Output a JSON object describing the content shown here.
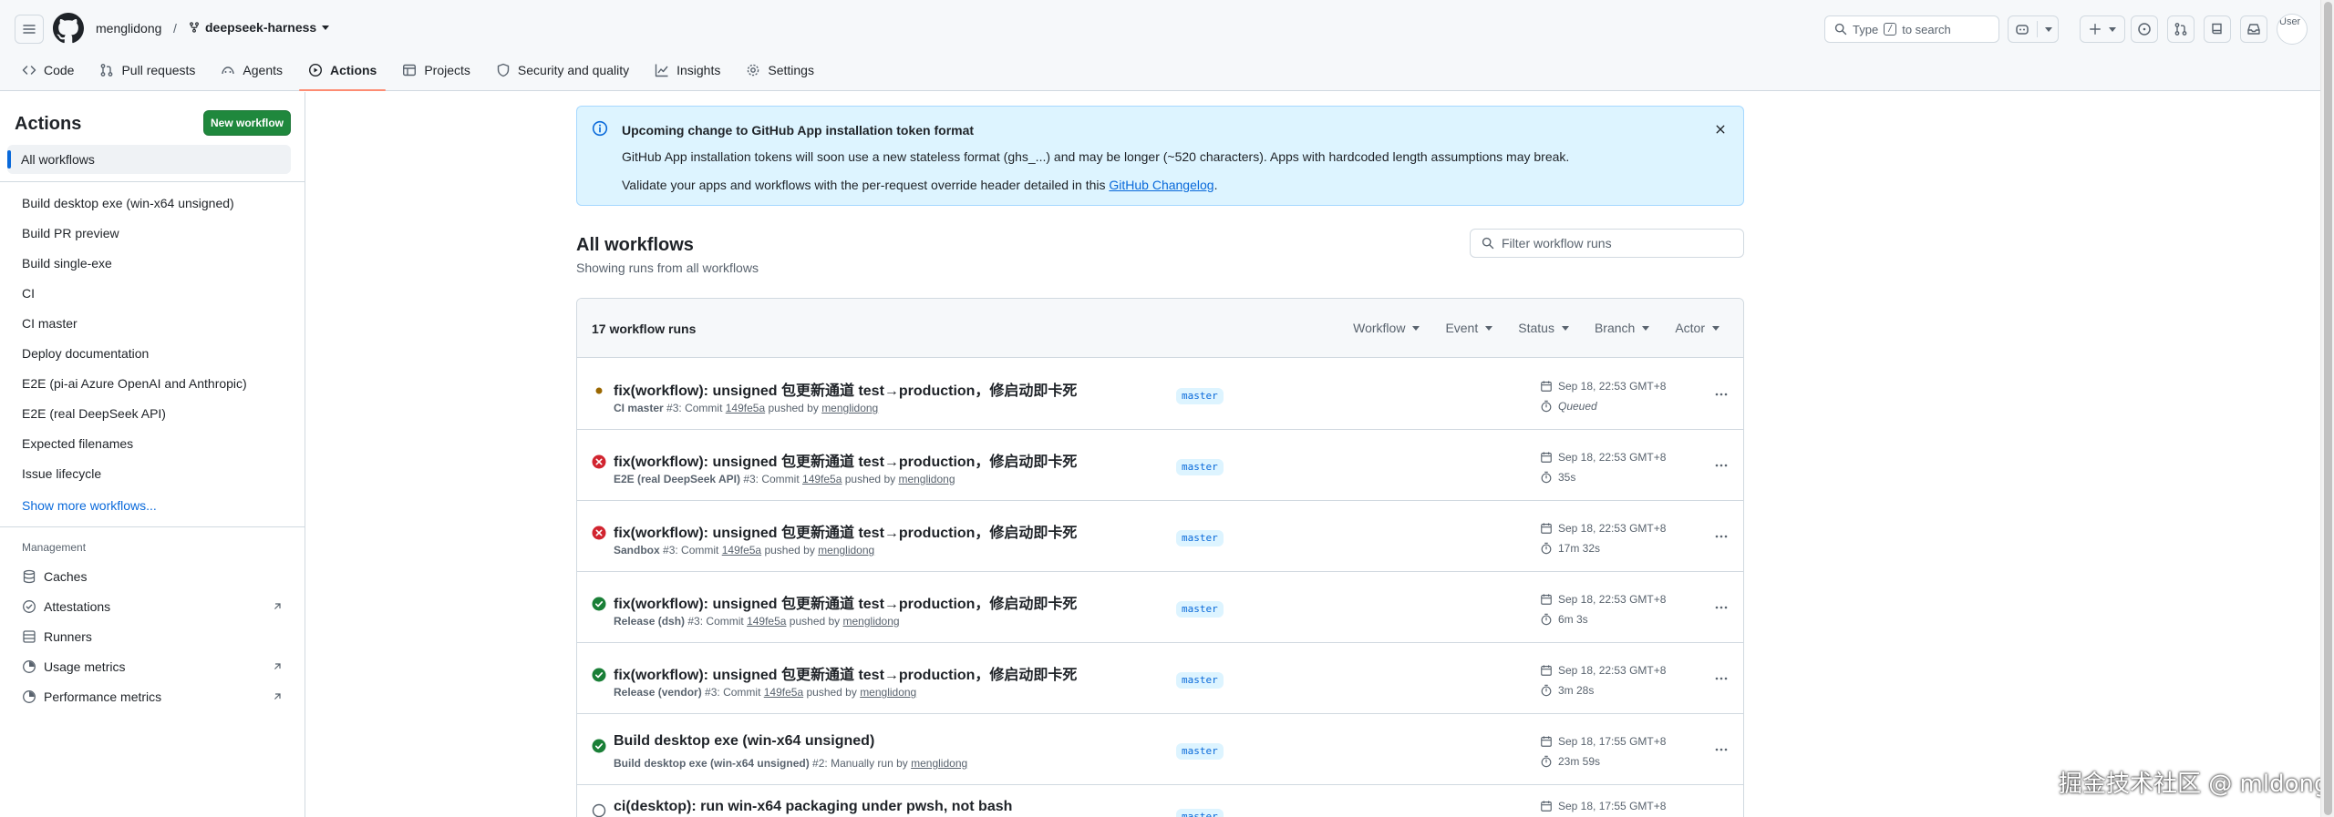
{
  "repo": {
    "owner": "menglidong",
    "separator": "/",
    "name": "deepseek-harness"
  },
  "search": {
    "prefix": "Type",
    "key": "/",
    "suffix": "to search"
  },
  "avatar_alt": "User",
  "nav": {
    "code": "Code",
    "pulls": "Pull requests",
    "agents": "Agents",
    "actions": "Actions",
    "projects": "Projects",
    "security": "Security and quality",
    "insights": "Insights",
    "settings": "Settings"
  },
  "sidebar": {
    "title": "Actions",
    "new_workflow": "New workflow",
    "all_workflows": "All workflows",
    "workflows": [
      "Build desktop exe (win-x64 unsigned)",
      "Build PR preview",
      "Build single-exe",
      "CI",
      "CI master",
      "Deploy documentation",
      "E2E (pi-ai Azure OpenAI and Anthropic)",
      "E2E (real DeepSeek API)",
      "Expected filenames",
      "Issue lifecycle"
    ],
    "show_more": "Show more workflows...",
    "management_label": "Management",
    "management": [
      "Caches",
      "Attestations",
      "Runners",
      "Usage metrics",
      "Performance metrics"
    ]
  },
  "banner": {
    "title": "Upcoming change to GitHub App installation token format",
    "line1": "GitHub App installation tokens will soon use a new stateless format (ghs_...) and may be longer (~520 characters). Apps with hardcoded length assumptions may break.",
    "line2_prefix": "Validate your apps and workflows with the per-request override header detailed in this ",
    "line2_link": "GitHub Changelog",
    "line2_suffix": "."
  },
  "main": {
    "title": "All workflows",
    "subtitle": "Showing runs from all workflows",
    "filter_placeholder": "Filter workflow runs",
    "count": "17 workflow runs",
    "filters": [
      "Workflow",
      "Event",
      "Status",
      "Branch",
      "Actor"
    ]
  },
  "runs": [
    {
      "status": "queued",
      "title": "fix(workflow): unsigned 包更新通道 test→production，修启动即卡死",
      "workflow": "CI master",
      "run_no": "#3",
      "verb": ": Commit ",
      "sha": "149fe5a",
      "by": " pushed by ",
      "actor": "menglidong",
      "branch": "master",
      "date": "Sep 18, 22:53 GMT+8",
      "duration": "Queued"
    },
    {
      "status": "failure",
      "title": "fix(workflow): unsigned 包更新通道 test→production，修启动即卡死",
      "workflow": "E2E (real DeepSeek API)",
      "run_no": "#3",
      "verb": ": Commit ",
      "sha": "149fe5a",
      "by": " pushed by ",
      "actor": "menglidong",
      "branch": "master",
      "date": "Sep 18, 22:53 GMT+8",
      "duration": "35s"
    },
    {
      "status": "failure",
      "title": "fix(workflow): unsigned 包更新通道 test→production，修启动即卡死",
      "workflow": "Sandbox",
      "run_no": "#3",
      "verb": ": Commit ",
      "sha": "149fe5a",
      "by": " pushed by ",
      "actor": "menglidong",
      "branch": "master",
      "date": "Sep 18, 22:53 GMT+8",
      "duration": "17m 32s"
    },
    {
      "status": "success",
      "title": "fix(workflow): unsigned 包更新通道 test→production，修启动即卡死",
      "workflow": "Release (dsh)",
      "run_no": "#3",
      "verb": ": Commit ",
      "sha": "149fe5a",
      "by": " pushed by ",
      "actor": "menglidong",
      "branch": "master",
      "date": "Sep 18, 22:53 GMT+8",
      "duration": "6m 3s"
    },
    {
      "status": "success",
      "title": "fix(workflow): unsigned 包更新通道 test→production，修启动即卡死",
      "workflow": "Release (vendor)",
      "run_no": "#3",
      "verb": ": Commit ",
      "sha": "149fe5a",
      "by": " pushed by ",
      "actor": "menglidong",
      "branch": "master",
      "date": "Sep 18, 22:53 GMT+8",
      "duration": "3m 28s"
    },
    {
      "status": "success",
      "title": "Build desktop exe (win-x64 unsigned)",
      "workflow": "Build desktop exe (win-x64 unsigned)",
      "run_no": "#2",
      "verb": ": Manually run by ",
      "sha": "",
      "by": "",
      "actor": "menglidong",
      "branch": "master",
      "date": "Sep 18, 17:55 GMT+8",
      "duration": "23m 59s"
    },
    {
      "status": "unknown",
      "title": "ci(desktop): run win-x64 packaging under pwsh, not bash",
      "workflow": "",
      "run_no": "",
      "verb": "",
      "sha": "",
      "by": "",
      "actor": "",
      "branch": "master",
      "date": "Sep 18, 17:55 GMT+8",
      "duration": ""
    }
  ],
  "watermark": "掘金技术社区 @ mldong",
  "colors": {
    "success": "#1a7f37",
    "failure": "#d1242f",
    "queued": "#9a6700",
    "accent": "#0969da",
    "primary_button": "#1f883d"
  }
}
